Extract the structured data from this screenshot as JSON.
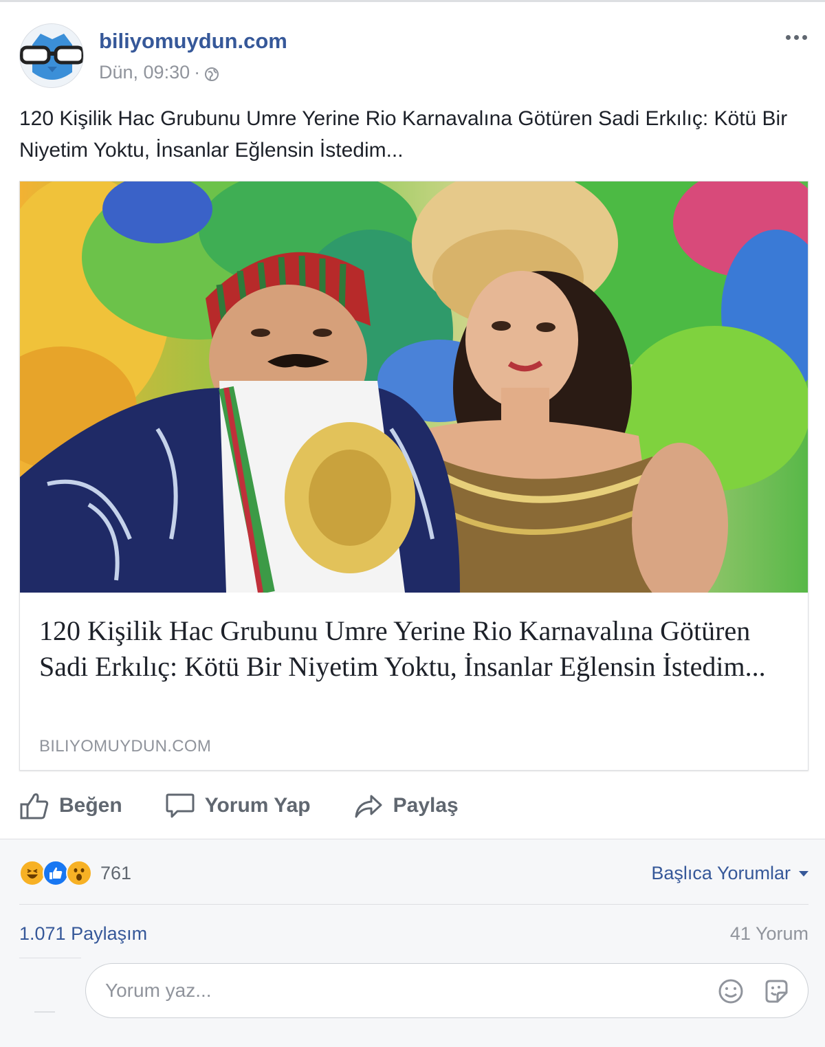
{
  "post": {
    "page_name": "biliyomuydun.com",
    "timestamp": "Dün, 09:30",
    "separator": "·",
    "text": "120 Kişilik Hac Grubunu Umre Yerine Rio Karnavalına Götüren Sadi Erkılıç: Kötü Bir Niyetim Yoktu, İnsanlar Eğlensin İstedim..."
  },
  "link": {
    "title": "120 Kişilik Hac Grubunu Umre Yerine Rio Karnavalına Götüren Sadi Erkılıç: Kötü Bir Niyetim Yoktu, İnsanlar Eğlensin İstedim...",
    "domain": "BILIYOMUYDUN.COM"
  },
  "actions": {
    "like_label": "Beğen",
    "comment_label": "Yorum Yap",
    "share_label": "Paylaş"
  },
  "reactions": {
    "icons": [
      "haha-reaction-icon",
      "like-reaction-icon",
      "wow-reaction-icon"
    ],
    "count": "761"
  },
  "comments_sort": {
    "label": "Başlıca Yorumlar"
  },
  "stats": {
    "shares": "1.071 Paylaşım",
    "comments": "41 Yorum"
  },
  "comment_box": {
    "placeholder": "Yorum yaz..."
  },
  "colors": {
    "link_blue": "#365899",
    "secondary_text": "#90949c",
    "action_gray": "#606770",
    "like_blue": "#1877f2",
    "reaction_yellow": "#f7b125",
    "footer_bg": "#f6f7f9"
  }
}
